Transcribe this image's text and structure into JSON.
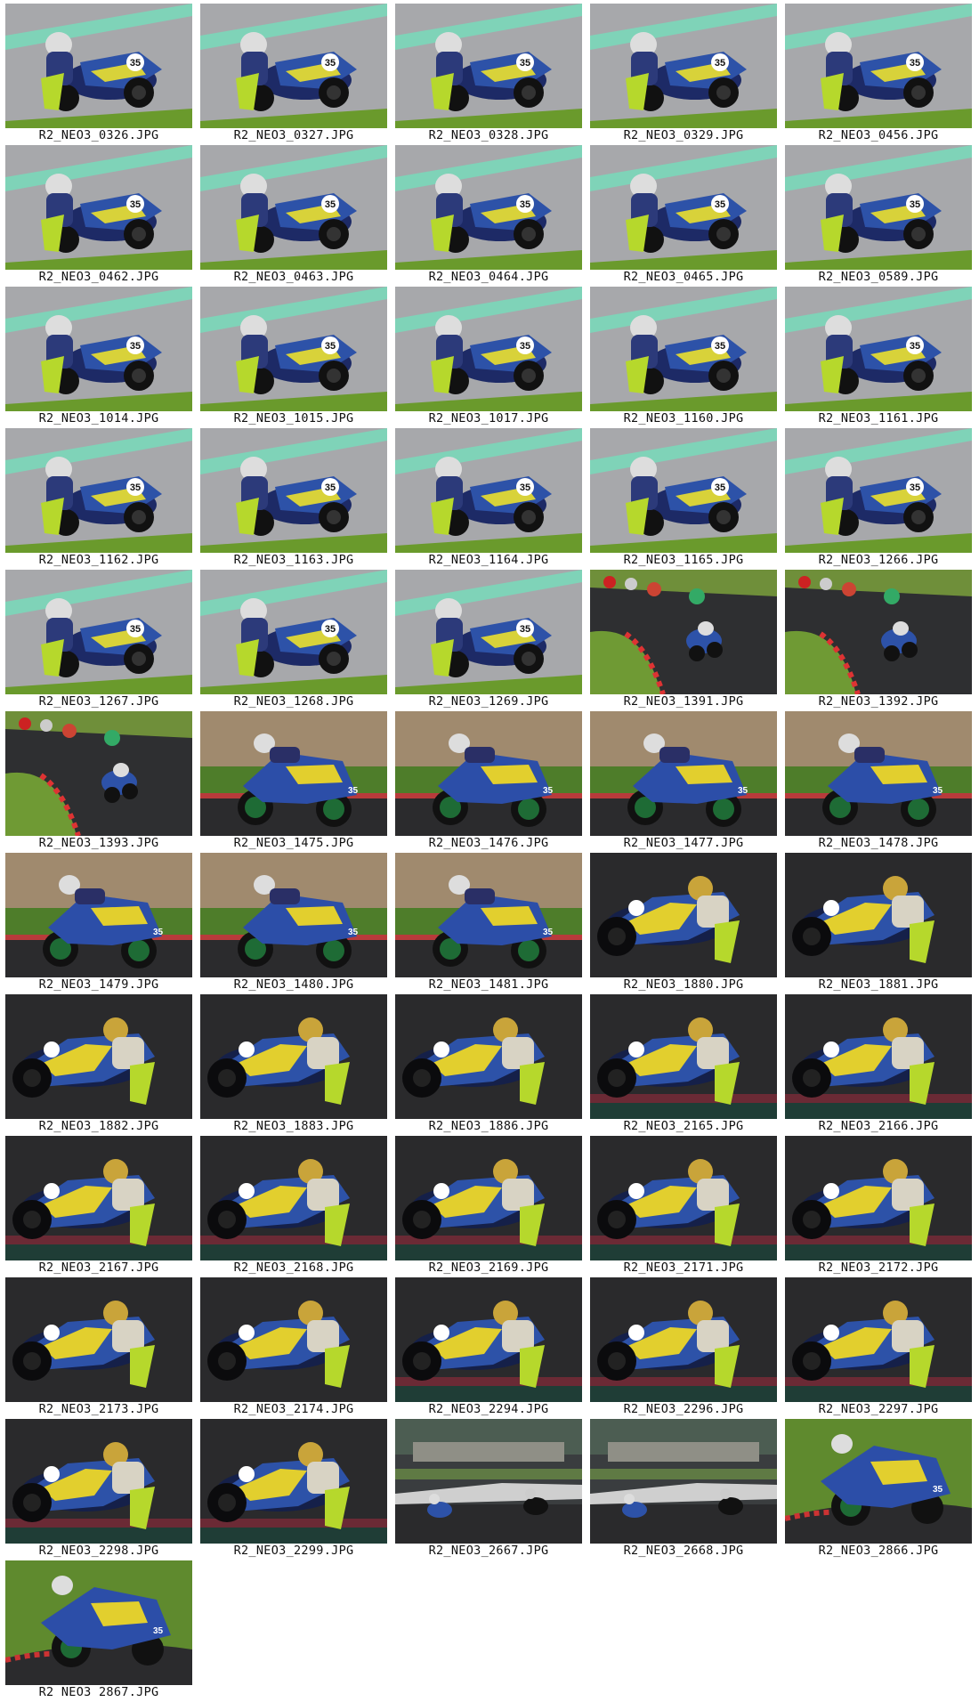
{
  "gallery": {
    "items": [
      {
        "filename": "R2_NEO3_0326.JPG",
        "scene": "lean-left-track",
        "bg": "#a7a8ab"
      },
      {
        "filename": "R2_NEO3_0327.JPG",
        "scene": "lean-left-track",
        "bg": "#a7a8ab"
      },
      {
        "filename": "R2_NEO3_0328.JPG",
        "scene": "lean-left-track",
        "bg": "#a7a8ab"
      },
      {
        "filename": "R2_NEO3_0329.JPG",
        "scene": "lean-left-track",
        "bg": "#a7a8ab"
      },
      {
        "filename": "R2_NEO3_0456.JPG",
        "scene": "lean-left-track",
        "bg": "#a7a8ab"
      },
      {
        "filename": "R2_NEO3_0462.JPG",
        "scene": "lean-left-track",
        "bg": "#a7a8ab"
      },
      {
        "filename": "R2_NEO3_0463.JPG",
        "scene": "lean-left-track",
        "bg": "#a7a8ab"
      },
      {
        "filename": "R2_NEO3_0464.JPG",
        "scene": "lean-left-track",
        "bg": "#a7a8ab"
      },
      {
        "filename": "R2_NEO3_0465.JPG",
        "scene": "lean-left-track",
        "bg": "#a7a8ab"
      },
      {
        "filename": "R2_NEO3_0589.JPG",
        "scene": "lean-left-track",
        "bg": "#a7a8ab"
      },
      {
        "filename": "R2_NEO3_1014.JPG",
        "scene": "lean-left-track",
        "bg": "#a7a8ab"
      },
      {
        "filename": "R2_NEO3_1015.JPG",
        "scene": "lean-left-track",
        "bg": "#a7a8ab"
      },
      {
        "filename": "R2_NEO3_1017.JPG",
        "scene": "lean-left-track",
        "bg": "#a7a8ab"
      },
      {
        "filename": "R2_NEO3_1160.JPG",
        "scene": "lean-left-track",
        "bg": "#a7a8ab"
      },
      {
        "filename": "R2_NEO3_1161.JPG",
        "scene": "lean-left-track",
        "bg": "#a7a8ab"
      },
      {
        "filename": "R2_NEO3_1162.JPG",
        "scene": "lean-left-track",
        "bg": "#a7a8ab"
      },
      {
        "filename": "R2_NEO3_1163.JPG",
        "scene": "lean-left-track",
        "bg": "#a7a8ab"
      },
      {
        "filename": "R2_NEO3_1164.JPG",
        "scene": "lean-left-track",
        "bg": "#a7a8ab"
      },
      {
        "filename": "R2_NEO3_1165.JPG",
        "scene": "lean-left-track",
        "bg": "#a7a8ab"
      },
      {
        "filename": "R2_NEO3_1266.JPG",
        "scene": "lean-left-track",
        "bg": "#a7a8ab"
      },
      {
        "filename": "R2_NEO3_1267.JPG",
        "scene": "lean-left-track",
        "bg": "#a7a8ab"
      },
      {
        "filename": "R2_NEO3_1268.JPG",
        "scene": "lean-left-track",
        "bg": "#a7a8ab"
      },
      {
        "filename": "R2_NEO3_1269.JPG",
        "scene": "lean-left-track",
        "bg": "#a7a8ab"
      },
      {
        "filename": "R2_NEO3_1391.JPG",
        "scene": "group-corner",
        "bg": "#6f8f3a"
      },
      {
        "filename": "R2_NEO3_1392.JPG",
        "scene": "group-corner",
        "bg": "#6f8f3a"
      },
      {
        "filename": "R2_NEO3_1393.JPG",
        "scene": "group-corner",
        "bg": "#6f8f3a"
      },
      {
        "filename": "R2_NEO3_1475.JPG",
        "scene": "side-view",
        "bg": "#a08a6e"
      },
      {
        "filename": "R2_NEO3_1476.JPG",
        "scene": "side-view",
        "bg": "#a08a6e"
      },
      {
        "filename": "R2_NEO3_1477.JPG",
        "scene": "side-view",
        "bg": "#a08a6e"
      },
      {
        "filename": "R2_NEO3_1478.JPG",
        "scene": "side-view",
        "bg": "#a08a6e"
      },
      {
        "filename": "R2_NEO3_1479.JPG",
        "scene": "side-view",
        "bg": "#a08a6e"
      },
      {
        "filename": "R2_NEO3_1480.JPG",
        "scene": "side-view",
        "bg": "#a08a6e"
      },
      {
        "filename": "R2_NEO3_1481.JPG",
        "scene": "side-view",
        "bg": "#a08a6e"
      },
      {
        "filename": "R2_NEO3_1880.JPG",
        "scene": "lean-right-dark",
        "bg": "#2a2a2c"
      },
      {
        "filename": "R2_NEO3_1881.JPG",
        "scene": "lean-right-dark",
        "bg": "#2a2a2c"
      },
      {
        "filename": "R2_NEO3_1882.JPG",
        "scene": "lean-right-dark",
        "bg": "#2a2a2c"
      },
      {
        "filename": "R2_NEO3_1883.JPG",
        "scene": "lean-right-dark",
        "bg": "#2a2a2c"
      },
      {
        "filename": "R2_NEO3_1886.JPG",
        "scene": "lean-right-dark",
        "bg": "#2a2a2c"
      },
      {
        "filename": "R2_NEO3_2165.JPG",
        "scene": "lean-right-dark-kerb",
        "bg": "#2a2a2c"
      },
      {
        "filename": "R2_NEO3_2166.JPG",
        "scene": "lean-right-dark-kerb",
        "bg": "#2a2a2c"
      },
      {
        "filename": "R2_NEO3_2167.JPG",
        "scene": "lean-right-dark-kerb",
        "bg": "#2a2a2c"
      },
      {
        "filename": "R2_NEO3_2168.JPG",
        "scene": "lean-right-dark-kerb",
        "bg": "#2a2a2c"
      },
      {
        "filename": "R2_NEO3_2169.JPG",
        "scene": "lean-right-dark-kerb",
        "bg": "#2a2a2c"
      },
      {
        "filename": "R2_NEO3_2171.JPG",
        "scene": "lean-right-dark-kerb",
        "bg": "#2a2a2c"
      },
      {
        "filename": "R2_NEO3_2172.JPG",
        "scene": "lean-right-dark-kerb",
        "bg": "#2a2a2c"
      },
      {
        "filename": "R2_NEO3_2173.JPG",
        "scene": "lean-right-dark",
        "bg": "#2a2a2c"
      },
      {
        "filename": "R2_NEO3_2174.JPG",
        "scene": "lean-right-dark",
        "bg": "#2a2a2c"
      },
      {
        "filename": "R2_NEO3_2294.JPG",
        "scene": "lean-right-dark-kerb",
        "bg": "#2a2a2c"
      },
      {
        "filename": "R2_NEO3_2296.JPG",
        "scene": "lean-right-dark-kerb",
        "bg": "#2a2a2c"
      },
      {
        "filename": "R2_NEO3_2297.JPG",
        "scene": "lean-right-dark-kerb",
        "bg": "#2a2a2c"
      },
      {
        "filename": "R2_NEO3_2298.JPG",
        "scene": "lean-right-dark-kerb",
        "bg": "#2a2a2c"
      },
      {
        "filename": "R2_NEO3_2299.JPG",
        "scene": "lean-right-dark-kerb",
        "bg": "#2a2a2c"
      },
      {
        "filename": "R2_NEO3_2667.JPG",
        "scene": "wide-two-bikes",
        "bg": "#3a3d3f"
      },
      {
        "filename": "R2_NEO3_2668.JPG",
        "scene": "wide-two-bikes",
        "bg": "#3a3d3f"
      },
      {
        "filename": "R2_NEO3_2866.JPG",
        "scene": "side-view-grass",
        "bg": "#5f8a2e"
      },
      {
        "filename": "R2_NEO3_2867.JPG",
        "scene": "side-view-grass",
        "bg": "#5f8a2e"
      }
    ]
  }
}
